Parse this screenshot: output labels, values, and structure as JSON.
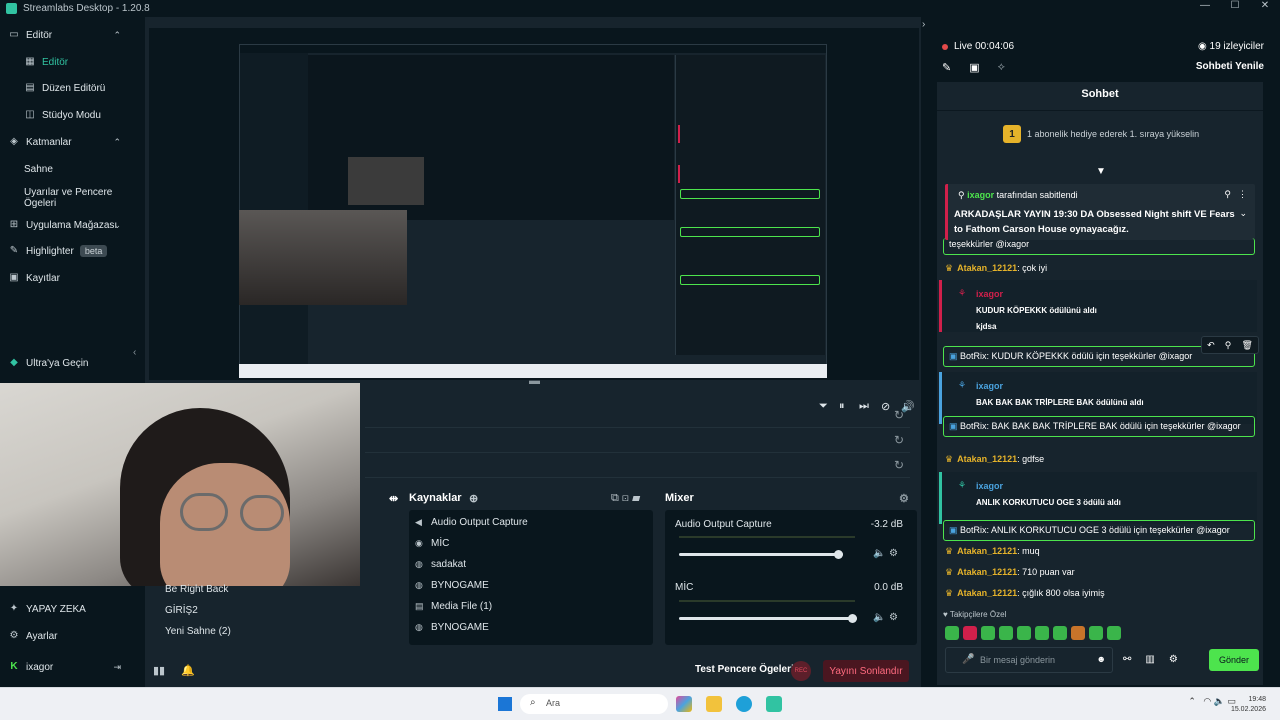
{
  "app": {
    "title": "Streamlabs Desktop - 1.20.8"
  },
  "sidebar": {
    "items": [
      {
        "label": "Editör",
        "icon": "monitor-icon",
        "chev": "⌃"
      },
      {
        "label": "Editör",
        "icon": "grid-icon"
      },
      {
        "label": "Düzen Editörü",
        "icon": "layout-icon"
      },
      {
        "label": "Stüdyo Modu",
        "icon": "studio-icon"
      },
      {
        "label": "Katmanlar",
        "icon": "layers-icon",
        "chev": "⌃"
      },
      {
        "label": "Sahne"
      },
      {
        "label": "Uyarılar ve Pencere Ögeleri"
      },
      {
        "label": "Uygulama Mağazası",
        "icon": "store-icon",
        "chev": "⌄"
      },
      {
        "label": "Highlighter",
        "icon": "highlighter-icon",
        "badge": "beta"
      },
      {
        "label": "Kayıtlar",
        "icon": "recordings-icon"
      }
    ],
    "ultra": "Ultra'ya Geçin",
    "bottom": [
      {
        "label": "YAPAY ZEKA",
        "icon": "ai-icon"
      },
      {
        "label": "Ayarlar",
        "icon": "gear-icon"
      },
      {
        "label": "ixagor",
        "icon": "kick-icon"
      }
    ]
  },
  "scenes": {
    "items": [
      "Be Right Back",
      "GİRİŞ2",
      "Yeni Sahne (2)"
    ]
  },
  "sources": {
    "title": "Kaynaklar",
    "items": [
      {
        "label": "Audio Output Capture",
        "icon": "speaker-icon"
      },
      {
        "label": "MİC",
        "icon": "mic-icon"
      },
      {
        "label": "sadakat",
        "icon": "text-icon"
      },
      {
        "label": "BYNOGAME",
        "icon": "browser-icon"
      },
      {
        "label": "Media File (1)",
        "icon": "media-icon"
      },
      {
        "label": "BYNOGAME",
        "icon": "browser-icon"
      }
    ]
  },
  "mixer": {
    "title": "Mixer",
    "channels": [
      {
        "name": "Audio Output Capture",
        "db": "-3.2 dB",
        "level": 0.92
      },
      {
        "name": "MİC",
        "db": "0.0 dB",
        "level": 1.0
      }
    ]
  },
  "footer": {
    "test": "Test Pencere Ögeleri",
    "rec": "REC",
    "end": "Yayını Sonlandır"
  },
  "right": {
    "live": "Live 00:04:06",
    "viewers": "19 izleyiciler",
    "refresh": "Sohbeti Yenile",
    "chat_title": "Sohbet",
    "gift_num": "1",
    "gift_text": "1 abonelik hediye ederek 1. sıraya yükselin",
    "pinned_by": "ixagor",
    "pinned_suffix": " tarafından sabitlendi",
    "pinned_body": "ARKADAŞLAR YAYIN 19:30 DA Obsessed Night shift VE Fears to Fathom Carson House oynayacağız.",
    "thanks_tail": "teşekkürler @ixagor",
    "messages": [
      {
        "user": "Atakan_12121",
        "text": ": çok iyi"
      },
      {
        "user": "Atakan_12121",
        "text": ": gdfse"
      },
      {
        "user": "Atakan_12121",
        "text": ": muq"
      },
      {
        "user": "Atakan_12121",
        "text": ": 710 puan var"
      },
      {
        "user": "Atakan_12121",
        "text": ": çığlık 800 olsa iyimiş"
      }
    ],
    "redeems": [
      {
        "user": "ixagor",
        "text": "KUDUR KÖPEKKK ödülünü aldı",
        "note": "kjdsa"
      },
      {
        "user": "ixagor",
        "text": "BAK BAK BAK TRİPLERE BAK ödülünü aldı"
      },
      {
        "user": "ixagor",
        "text": "ANLIK KORKUTUCU OGE 3 ödülü aldı"
      }
    ],
    "bot": [
      {
        "user": "BotRix",
        "text": ": KUDUR KÖPEKKK ödülü için teşekkürler @ixagor"
      },
      {
        "user": "BotRix",
        "text": ": BAK BAK BAK TRİPLERE BAK ödülü için teşekkürler @ixagor"
      },
      {
        "user": "BotRix",
        "text": ": ANLIK KORKUTUCU OGE 3 ödülü için teşekkürler @ixagor"
      }
    ],
    "followers_label": "Takipçilere Özel",
    "input_placeholder": "Bir mesaj gönderin",
    "send": "Gönder"
  },
  "taskbar": {
    "search": "Ara",
    "time": "19:48",
    "date": "15.02.2026"
  }
}
